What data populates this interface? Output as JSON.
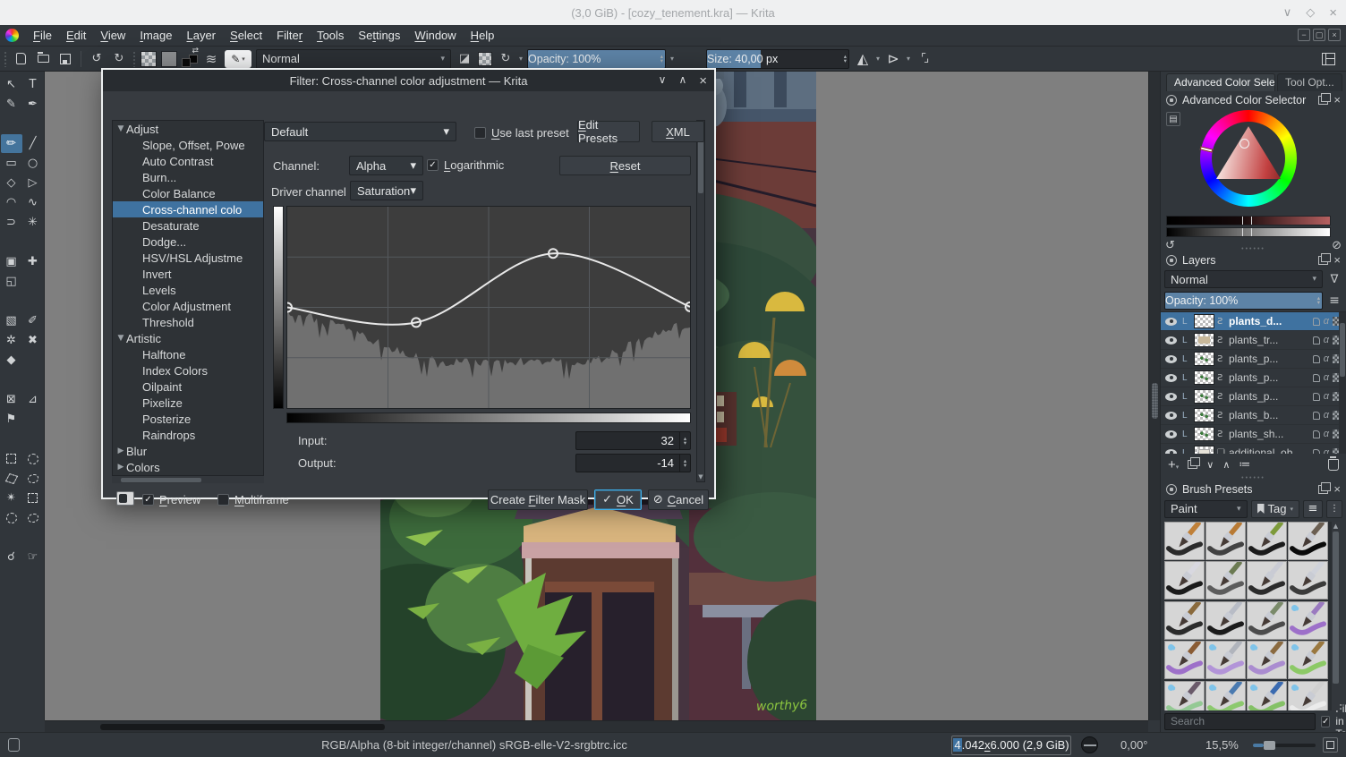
{
  "window": {
    "title": "(3,0 GiB) - [cozy_tenement.kra] — Krita",
    "controls": {
      "minimize": "∨",
      "maximize": "◇",
      "close": "×"
    },
    "mdi_controls": {
      "minimize": "−",
      "restore": "▢",
      "close": "×"
    }
  },
  "menubar": {
    "items": [
      {
        "label": "File",
        "u": 0
      },
      {
        "label": "Edit",
        "u": 0
      },
      {
        "label": "View",
        "u": 0
      },
      {
        "label": "Image",
        "u": 0
      },
      {
        "label": "Layer",
        "u": 0
      },
      {
        "label": "Select",
        "u": 0
      },
      {
        "label": "Filter",
        "u": 5
      },
      {
        "label": "Tools",
        "u": 0
      },
      {
        "label": "Settings",
        "u": 2
      },
      {
        "label": "Window",
        "u": 0
      },
      {
        "label": "Help",
        "u": 0
      }
    ]
  },
  "toolbar": {
    "blend_mode": "Normal",
    "opacity_label": "Opacity: 100%",
    "opacity_fill_pct": 100,
    "size_label": "Size: 40,00 px",
    "size_fill_pct": 38
  },
  "toolbox": {
    "tools": [
      {
        "name": "select-shapes",
        "glyph": "↖"
      },
      {
        "name": "text",
        "glyph": "T"
      },
      {
        "name": "edit-shapes",
        "glyph": "✎"
      },
      {
        "name": "calligraphy",
        "glyph": "✒"
      },
      {
        "gap": true
      },
      {
        "name": "freehand-brush",
        "glyph": "✏",
        "selected": true
      },
      {
        "name": "line",
        "glyph": "╱"
      },
      {
        "name": "rectangle",
        "glyph": "▭"
      },
      {
        "name": "ellipse",
        "glyph": "○"
      },
      {
        "name": "polygon",
        "glyph": "◇"
      },
      {
        "name": "polyline",
        "glyph": "▷"
      },
      {
        "name": "bezier-curve",
        "glyph": "◠"
      },
      {
        "name": "freehand-path",
        "glyph": "∿"
      },
      {
        "name": "dynamic-brush",
        "glyph": "⊃"
      },
      {
        "name": "multibrush",
        "glyph": "✳"
      },
      {
        "gap": true
      },
      {
        "name": "transform",
        "glyph": "▣"
      },
      {
        "name": "move",
        "glyph": "✚"
      },
      {
        "name": "crop",
        "glyph": "◱"
      },
      {
        "blank": true
      },
      {
        "gap": true
      },
      {
        "name": "gradient",
        "glyph": "▧"
      },
      {
        "name": "color-sampler",
        "glyph": "✐"
      },
      {
        "name": "pattern-edit",
        "glyph": "✲"
      },
      {
        "name": "smart-patch",
        "glyph": "✖"
      },
      {
        "name": "fill",
        "glyph": "◆"
      },
      {
        "blank": true
      },
      {
        "gap": true
      },
      {
        "name": "enclose-fill",
        "glyph": "⊠"
      },
      {
        "name": "assistants",
        "glyph": "⊿"
      },
      {
        "name": "reference-images",
        "glyph": "⚑"
      },
      {
        "blank": true
      },
      {
        "gap": true
      },
      {
        "name": "rect-select",
        "shape": "dashsq"
      },
      {
        "name": "ellipse-select",
        "shape": "dashci"
      },
      {
        "name": "polygonal-select",
        "shape": "dashpo"
      },
      {
        "name": "freehand-select",
        "shape": "dashfr"
      },
      {
        "name": "contiguous-select",
        "glyph": "✴"
      },
      {
        "name": "similar-color-select",
        "shape": "dashsq"
      },
      {
        "name": "bezier-select",
        "shape": "dashci"
      },
      {
        "name": "magnetic-select",
        "shape": "dashfr"
      },
      {
        "gap": true
      },
      {
        "name": "zoom",
        "glyph": "☌"
      },
      {
        "name": "pan",
        "glyph": "☞"
      }
    ]
  },
  "dialog": {
    "title": "Filter: Cross-channel color adjustment — Krita",
    "controls": {
      "shade": "∨",
      "maximize": "∧",
      "close": "×"
    },
    "preset_value": "Default",
    "use_last_preset": {
      "label": "Use last preset",
      "u": 0,
      "checked": false
    },
    "edit_presets": {
      "label": "Edit Presets",
      "u": 0
    },
    "xml": {
      "label": "XML",
      "u": 0
    },
    "channel_label": "Channel:",
    "channel_value": "Alpha",
    "logarithmic": {
      "label": "Logarithmic",
      "u": 0,
      "checked": true
    },
    "reset": {
      "label": "Reset",
      "u": 0
    },
    "driver_label": "Driver channel",
    "driver_value": "Saturation",
    "input_label": "Input:",
    "input_value": "32",
    "output_label": "Output:",
    "output_value": "-14",
    "preview": {
      "label": "Preview",
      "u": 0,
      "checked": true
    },
    "multiframe": {
      "label": "Multiframe",
      "u": 0,
      "checked": false
    },
    "create_filter_mask": {
      "label": "Create Filter Mask",
      "u": 7
    },
    "ok": {
      "label": "OK",
      "u": 0,
      "icon": "✓"
    },
    "cancel": {
      "label": "Cancel",
      "u": 0,
      "icon": "⊘"
    },
    "curve": {
      "points_frac": [
        [
          0.0,
          0.5
        ],
        [
          0.32,
          0.575
        ],
        [
          0.66,
          0.232
        ],
        [
          1.0,
          0.497
        ]
      ]
    },
    "filter_tree": [
      {
        "label": "Adjust",
        "level": 0,
        "state": "expanded"
      },
      {
        "label": "Slope, Offset, Powe",
        "level": 1
      },
      {
        "label": "Auto Contrast",
        "level": 1
      },
      {
        "label": "Burn...",
        "level": 1
      },
      {
        "label": "Color Balance",
        "level": 1
      },
      {
        "label": "Cross-channel colo",
        "level": 1,
        "selected": true
      },
      {
        "label": "Desaturate",
        "level": 1
      },
      {
        "label": "Dodge...",
        "level": 1
      },
      {
        "label": "HSV/HSL Adjustme",
        "level": 1
      },
      {
        "label": "Invert",
        "level": 1
      },
      {
        "label": "Levels",
        "level": 1
      },
      {
        "label": "Color Adjustment",
        "level": 1
      },
      {
        "label": "Threshold",
        "level": 1
      },
      {
        "label": "Artistic",
        "level": 0,
        "state": "expanded"
      },
      {
        "label": "Halftone",
        "level": 1
      },
      {
        "label": "Index Colors",
        "level": 1
      },
      {
        "label": "Oilpaint",
        "level": 1
      },
      {
        "label": "Pixelize",
        "level": 1
      },
      {
        "label": "Posterize",
        "level": 1
      },
      {
        "label": "Raindrops",
        "level": 1
      },
      {
        "label": "Blur",
        "level": 0,
        "state": "collapsed"
      },
      {
        "label": "Colors",
        "level": 0,
        "state": "collapsed"
      }
    ]
  },
  "canvas": {
    "signature": "worthy6"
  },
  "right_panel": {
    "tabs": [
      {
        "label": "Advanced Color Sele...",
        "active": true
      },
      {
        "label": "Tool Opt...",
        "active": false
      }
    ],
    "color_selector": {
      "title": "Advanced Color Selector"
    },
    "layers": {
      "title": "Layers",
      "blend_mode": "Normal",
      "opacity_label": "Opacity:  100%",
      "rows": [
        {
          "name": "plants_d...",
          "selected": true,
          "thumb": "plain"
        },
        {
          "name": "plants_tr...",
          "thumb": "tan"
        },
        {
          "name": "plants_p...",
          "thumb": "green"
        },
        {
          "name": "plants_p...",
          "thumb": "green"
        },
        {
          "name": "plants_p...",
          "thumb": "green"
        },
        {
          "name": "plants_b...",
          "thumb": "green"
        },
        {
          "name": "plants_sh...",
          "thumb": "green"
        },
        {
          "name": "additional_ob...",
          "thumb": "sketch",
          "group": true
        }
      ]
    },
    "brushes": {
      "title": "Brush Presets",
      "category": "Paint",
      "tag_label": "Tag",
      "search_placeholder": "Search",
      "filter_in_tag": {
        "label": "Filter in Tag",
        "checked": true
      },
      "tiles": [
        {
          "h": "#c08038",
          "s": "#222222",
          "d": false
        },
        {
          "h": "#b87a34",
          "s": "#3a3a3a",
          "d": false
        },
        {
          "h": "#7d9a3a",
          "s": "#111111",
          "d": false
        },
        {
          "h": "#6b5f52",
          "s": "#000000",
          "d": false
        },
        {
          "h": "#d8d8e0",
          "s": "#111111",
          "d": false
        },
        {
          "h": "#6b7a52",
          "s": "#555555",
          "d": false
        },
        {
          "h": "#c9cbd4",
          "s": "#222222",
          "d": false
        },
        {
          "h": "#cfd2da",
          "s": "#333333",
          "d": false
        },
        {
          "h": "#8a6a3c",
          "s": "#222222",
          "d": false
        },
        {
          "h": "#b8bcc6",
          "s": "#111111",
          "d": false
        },
        {
          "h": "#7a8a6a",
          "s": "#444444",
          "d": false
        },
        {
          "h": "#9a7ac0",
          "s": "#9a6ac8",
          "d": true
        },
        {
          "h": "#8a5c34",
          "s": "#9a6ac8",
          "d": true
        },
        {
          "h": "#b0b4bc",
          "s": "#b090d8",
          "d": true
        },
        {
          "h": "#8a6a40",
          "s": "#a888d0",
          "d": true
        },
        {
          "h": "#9a7840",
          "s": "#88c860",
          "d": true
        },
        {
          "h": "#6a5a6a",
          "s": "#90c890",
          "d": true
        },
        {
          "h": "#4a7ab0",
          "s": "#88c868",
          "d": true
        },
        {
          "h": "#3a6ab0",
          "s": "#80c060",
          "d": true
        },
        {
          "h": "#d0d0d0",
          "s": "#ececec",
          "d": true
        }
      ]
    }
  },
  "statusbar": {
    "color_profile": "RGB/Alpha (8-bit integer/channel)  sRGB-elle-V2-srgbtrc.icc",
    "dimensions": {
      "sel": "4",
      "mid": ".042 ",
      "u": "x",
      "rest": " 6.000 (2,9 GiB)"
    },
    "angle": "0,00°",
    "zoom": "15,5%"
  },
  "colors": {
    "accent": "#3daee9",
    "selection_blue": "#3f72a0",
    "slider_fill": "#5d83a6",
    "panel_bg": "#31363b",
    "canvas_bg": "#7f7f7f",
    "curve_bg": "#3d3d3d",
    "histogram": "#707070"
  }
}
